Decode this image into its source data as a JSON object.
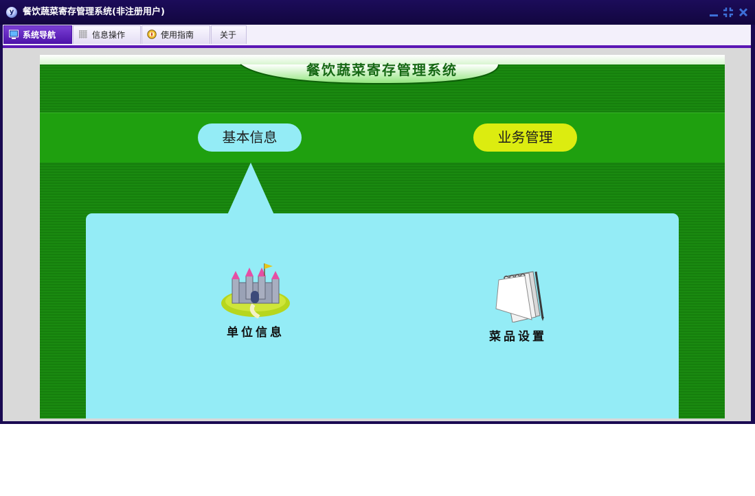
{
  "window": {
    "title": "餐饮蔬菜寄存管理系统(非注册用户)",
    "logo_letter": "y",
    "controls": [
      "minimize-icon",
      "restore-icon",
      "close-icon"
    ]
  },
  "tabs": [
    {
      "label": "系统导航",
      "icon": "monitor-icon",
      "active": true
    },
    {
      "label": "信息操作",
      "icon": "grid-icon",
      "active": false
    },
    {
      "label": "使用指南",
      "icon": "compass-icon",
      "active": false
    },
    {
      "label": "关于",
      "icon": "",
      "active": false
    }
  ],
  "panel": {
    "banner_title": "餐饮蔬菜寄存管理系统",
    "nav_buttons": {
      "basic_info": "基本信息",
      "business": "业务管理"
    },
    "features": [
      {
        "label": "单位信息",
        "icon": "castle-icon"
      },
      {
        "label": "菜品设置",
        "icon": "notepad-icon"
      }
    ]
  },
  "colors": {
    "titlebar": "#1c0c5a",
    "tab_active": "#5b17b5",
    "panel_green": "#1a8a10",
    "nav_band": "#1fa00f",
    "callout_cyan": "#94ecf6",
    "business_pill": "#dcec10"
  }
}
